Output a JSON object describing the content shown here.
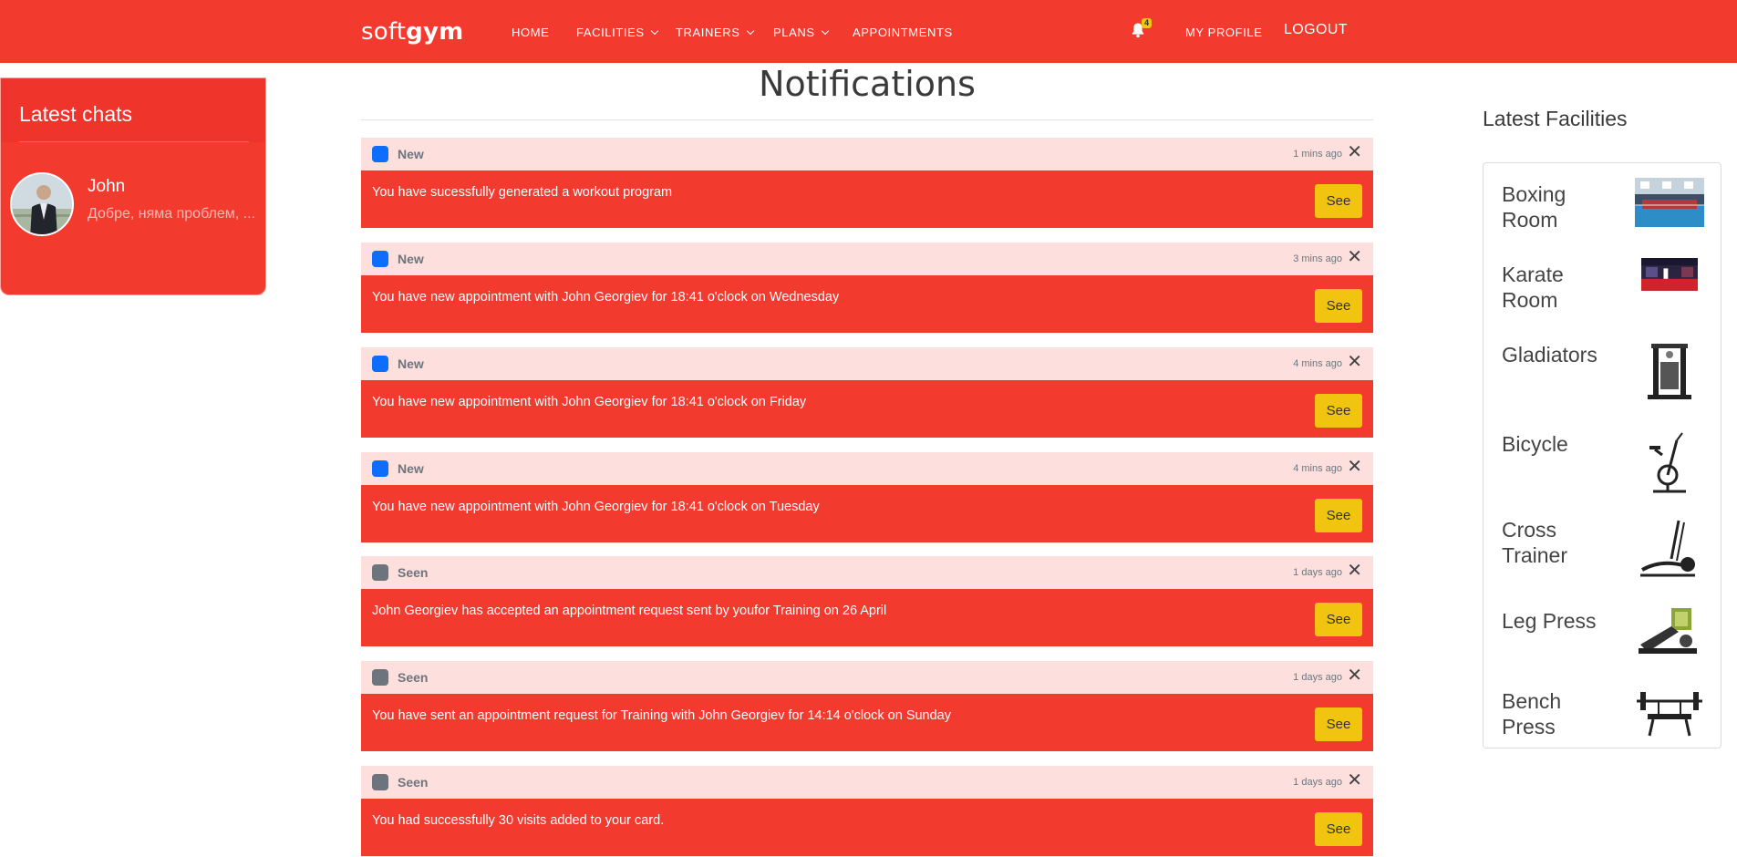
{
  "nav": {
    "brand_light": "soft",
    "brand_bold": "gym",
    "home": "HOME",
    "facilities": "FACILITIES",
    "trainers": "TRAINERS",
    "plans": "PLANS",
    "appointments": "APPOINTMENTS",
    "notification_count": "4",
    "my_profile": "MY PROFILE",
    "logout": "LOGOUT"
  },
  "chats": {
    "title": "Latest chats",
    "items": [
      {
        "name": "John",
        "message": "Добре, няма проблем, ..."
      }
    ]
  },
  "main": {
    "title": "Notifications",
    "see_label": "See",
    "notifications": [
      {
        "status": "New",
        "time": "1 mins ago",
        "text": "You have sucessfully generated a workout program",
        "color": "#0d6efd"
      },
      {
        "status": "New",
        "time": "3 mins ago",
        "text": "You have new appointment with John Georgiev for 18:41 o'clock on Wednesday",
        "color": "#0d6efd"
      },
      {
        "status": "New",
        "time": "4 mins ago",
        "text": "You have new appointment with John Georgiev for 18:41 o'clock on Friday",
        "color": "#0d6efd"
      },
      {
        "status": "New",
        "time": "4 mins ago",
        "text": "You have new appointment with John Georgiev for 18:41 o'clock on Tuesday",
        "color": "#0d6efd"
      },
      {
        "status": "Seen",
        "time": "1 days ago",
        "text": "John Georgiev has accepted an appointment request sent by youfor Training on 26 April",
        "color": "#6c757d"
      },
      {
        "status": "Seen",
        "time": "1 days ago",
        "text": "You have sent an appointment request for Training with John Georgiev for 14:14 o'clock on Sunday",
        "color": "#6c757d"
      },
      {
        "status": "Seen",
        "time": "1 days ago",
        "text": "You had successfully 30 visits added to your card.",
        "color": "#6c757d"
      }
    ]
  },
  "facilities": {
    "title": "Latest Facilities",
    "items": [
      {
        "name": "Boxing Room",
        "icon": "boxing-room-photo"
      },
      {
        "name": "Karate Room",
        "icon": "karate-room-photo"
      },
      {
        "name": "Gladiators",
        "icon": "gladiators-machine"
      },
      {
        "name": "Bicycle",
        "icon": "exercise-bike"
      },
      {
        "name": "Cross Trainer",
        "icon": "cross-trainer"
      },
      {
        "name": "Leg Press",
        "icon": "leg-press-machine"
      },
      {
        "name": "Bench Press",
        "icon": "bench-press"
      }
    ]
  },
  "colors": {
    "primary": "#f23a2f",
    "header_tint": "#fde0dd",
    "button": "#f1c40f",
    "new_badge": "#0d6efd",
    "seen_badge": "#6c757d"
  }
}
